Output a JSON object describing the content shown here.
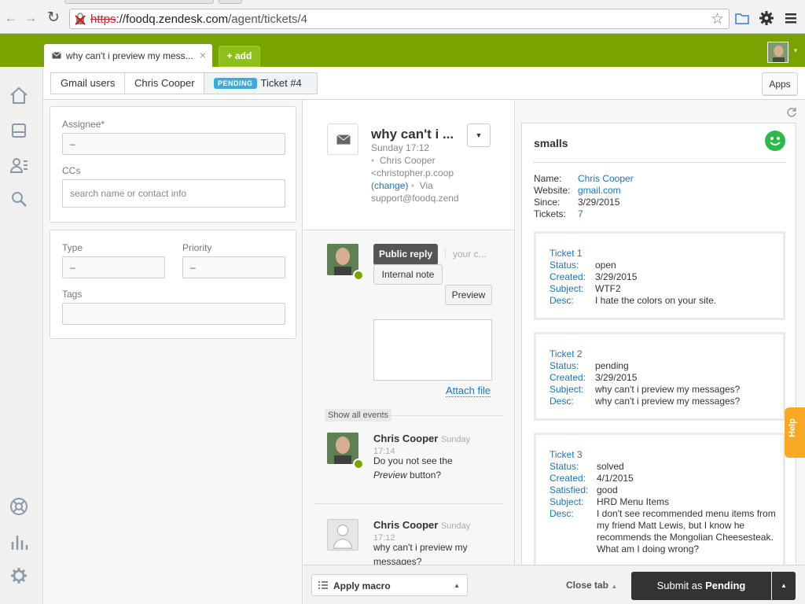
{
  "browser": {
    "url_scheme": "https",
    "url_domain": "://foodq.zendesk.com",
    "url_path": "/agent/tickets/4"
  },
  "topbar": {
    "tab_title": "why can't i preview my mess...",
    "add_label": "+ add"
  },
  "subnav": {
    "crumb1": "Gmail users",
    "crumb2": "Chris Cooper",
    "status_badge": "PENDING",
    "crumb3": "Ticket #4",
    "apps_label": "Apps"
  },
  "properties": {
    "assignee_label": "Assignee*",
    "assignee_value": "–",
    "ccs_label": "CCs",
    "ccs_placeholder": "search name or contact info",
    "type_label": "Type",
    "type_value": "–",
    "priority_label": "Priority",
    "priority_value": "–",
    "tags_label": "Tags"
  },
  "conversation": {
    "subject": "why can't i ...",
    "time": "Sunday 17:12",
    "requester": "Chris Cooper",
    "requester_email": "<christopher.p.coop",
    "change_link": "(change)",
    "via_label": "Via",
    "via_address": "support@foodq.zend",
    "public_reply": "Public reply",
    "reply_placeholder": "your c...",
    "internal_note": "Internal note",
    "preview": "Preview",
    "attach_file": "Attach file",
    "show_all_events": "Show all events",
    "comments": [
      {
        "author": "Chris Cooper",
        "time_day": "Sunday",
        "time_clock": "17:14",
        "text_pre": "Do you not see the",
        "text_em": "Preview",
        "text_post": " button?"
      },
      {
        "author": "Chris Cooper",
        "time_day": "Sunday",
        "time_clock": "17:12",
        "text": "why can't i preview my messages?"
      }
    ]
  },
  "app": {
    "title": "smalls",
    "name_label": "Name:",
    "name_value": "Chris Cooper",
    "website_label": "Website:",
    "website_value": "gmail.com",
    "since_label": "Since:",
    "since_value": "3/29/2015",
    "tickets_label": "Tickets:",
    "tickets_value": "7",
    "tickets": [
      {
        "title": "Ticket 1",
        "status": "open",
        "created": "3/29/2015",
        "subject": "WTF2",
        "desc": "I hate the colors on your site."
      },
      {
        "title": "Ticket 2",
        "status": "pending",
        "created": "3/29/2015",
        "subject": "why can't i preview my messages?",
        "desc": "why can't i preview my messages?"
      },
      {
        "title": "Ticket 3",
        "status": "solved",
        "created": "4/1/2015",
        "satisfied": "good",
        "subject": "HRD Menu Items",
        "desc": "I don't see recommended menu items from my friend Matt Lewis, but I know he recommends the Mongolian Cheesesteak. What am I doing wrong?"
      }
    ],
    "labels": {
      "status": "Status:",
      "created": "Created:",
      "subject": "Subject:",
      "desc": "Desc:",
      "satisfied": "Satisfied:"
    }
  },
  "help_label": "Help",
  "footer": {
    "apply_macro": "Apply macro",
    "close_tab": "Close tab",
    "submit_prefix": "Submit as ",
    "submit_status": "Pending"
  },
  "colors": {
    "brand_green": "#78a300",
    "pending_blue": "#3fa9d9",
    "link_blue": "#1f73b7",
    "help_orange": "#f9a825"
  }
}
